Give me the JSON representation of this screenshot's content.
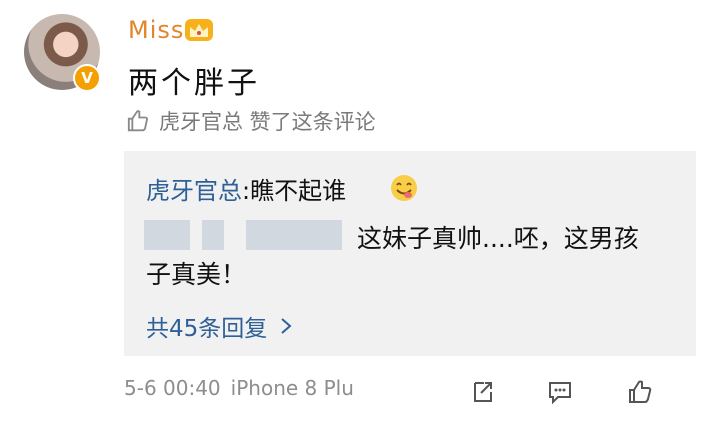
{
  "user": {
    "name": "Miss",
    "verify_badge": "V",
    "crown_icon": "crown-icon",
    "avatar_alt": "avatar"
  },
  "comment": {
    "text": "两个胖子"
  },
  "like_line": {
    "text": "虎牙官总 赞了这条评论",
    "icon": "thumbs-up-icon"
  },
  "reply": {
    "author": "虎牙官总",
    "author_suffix": ":瞧不起谁",
    "emoji": "yum-emoji",
    "text_line1": "这妹子真帅....呸，这男孩",
    "text_line2": "子真美！",
    "count_text": "共45条回复",
    "chevron_icon": "chevron-right-icon"
  },
  "footer": {
    "timestamp": "5-6 00:40",
    "device": "iPhone 8 Plu",
    "share_icon": "share-icon",
    "comment_icon": "comment-icon",
    "like_icon": "like-icon"
  },
  "colors": {
    "username": "#e3852a",
    "link": "#2e5f96",
    "reply_bg": "#f1f1f1"
  }
}
